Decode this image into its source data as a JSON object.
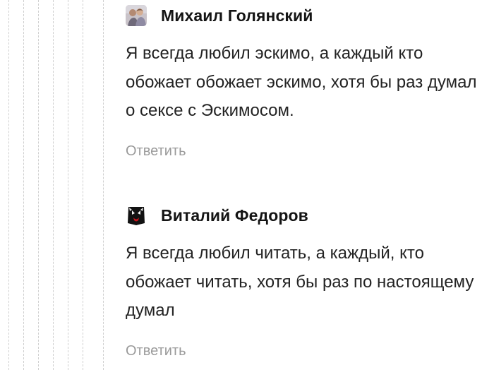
{
  "comments": [
    {
      "author": "Михаил Голянский",
      "text": "Я всегда любил эскимо, а каждый кто обожает обожает эскимо, хотя бы раз думал о сексе с Эскимосом.",
      "reply_label": "Ответить"
    },
    {
      "author": "Виталий Федоров",
      "text": "Я всегда любил читать, а каждый, кто обожает читать, хотя бы раз по настоящему думал",
      "reply_label": "Ответить"
    }
  ],
  "colors": {
    "guide": "#cfcfcf",
    "reply": "#9a9a9a",
    "text": "#232323"
  }
}
